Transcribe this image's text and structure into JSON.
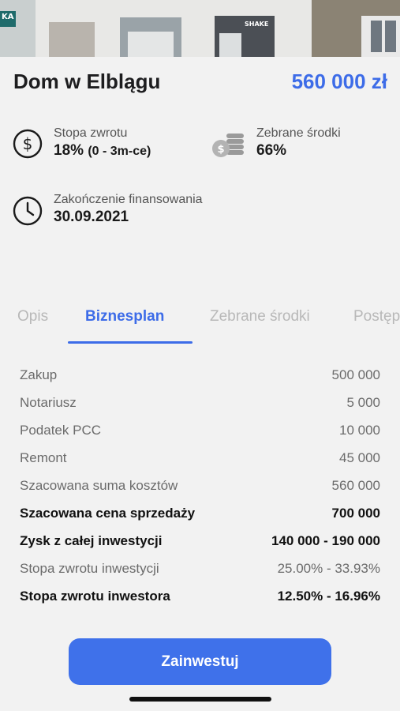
{
  "hero": {
    "sign_left": "KA",
    "sign_right": "SHAKE"
  },
  "listing": {
    "title": "Dom w Elblągu",
    "price": "560 000 zł"
  },
  "stats": {
    "return_label": "Stopa zwrotu",
    "return_value": "18%",
    "return_period": "(0 - 3m-ce)",
    "raised_label": "Zebrane środki",
    "raised_value": "66%",
    "end_label": "Zakończenie finansowania",
    "end_value": "30.09.2021"
  },
  "tabs": [
    "Opis",
    "Biznesplan",
    "Zebrane środki",
    "Postęp"
  ],
  "active_tab": "Biznesplan",
  "plan": [
    {
      "label": "Zakup",
      "value": "500 000",
      "bold": false
    },
    {
      "label": "Notariusz",
      "value": "5 000",
      "bold": false
    },
    {
      "label": "Podatek PCC",
      "value": "10 000",
      "bold": false
    },
    {
      "label": "Remont",
      "value": "45 000",
      "bold": false
    },
    {
      "label": "Szacowana suma kosztów",
      "value": "560 000",
      "bold": false
    },
    {
      "label": "Szacowana cena sprzedaży",
      "value": "700 000",
      "bold": true
    },
    {
      "label": "Zysk z całej inwestycji",
      "value": "140 000 - 190 000",
      "bold": true
    },
    {
      "label": "Stopa zwrotu inwestycji",
      "value": "25.00% - 33.93%",
      "bold": false
    },
    {
      "label": "Stopa zwrotu inwestora",
      "value": "12.50% - 16.96%",
      "bold": true
    }
  ],
  "cta": {
    "label": "Zainwestuj"
  },
  "colors": {
    "accent": "#3d6ce8",
    "background": "#f2f2f2"
  },
  "icons": [
    "dollar-circle-icon",
    "coin-stack-icon",
    "clock-icon"
  ]
}
